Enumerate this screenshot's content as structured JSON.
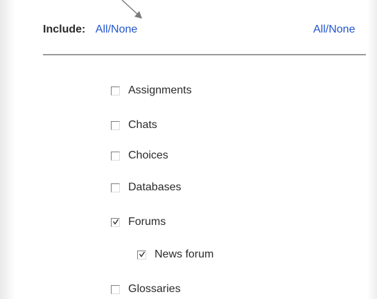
{
  "header": {
    "include_label": "Include:",
    "all_none_left": "All/None",
    "all_none_right": "All/None"
  },
  "items": [
    {
      "label": "Assignments",
      "checked": false
    },
    {
      "label": "Chats",
      "checked": false
    },
    {
      "label": "Choices",
      "checked": false
    },
    {
      "label": "Databases",
      "checked": false
    },
    {
      "label": "Forums",
      "checked": true
    },
    {
      "label": "News forum",
      "checked": true
    },
    {
      "label": "Glossaries",
      "checked": false
    }
  ],
  "colors": {
    "link": "#2255cc",
    "divider": "#9a9a9a"
  }
}
